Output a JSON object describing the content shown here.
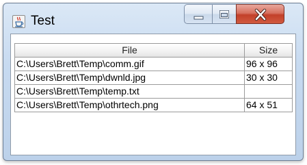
{
  "window": {
    "title": "Test"
  },
  "table": {
    "columns": [
      "File",
      "Size"
    ],
    "rows": [
      {
        "file": "C:\\Users\\Brett\\Temp\\comm.gif",
        "size": "96 x 96"
      },
      {
        "file": "C:\\Users\\Brett\\Temp\\dwnld.jpg",
        "size": "30 x 30"
      },
      {
        "file": "C:\\Users\\Brett\\Temp\\temp.txt",
        "size": ""
      },
      {
        "file": "C:\\Users\\Brett\\Temp\\othrtech.png",
        "size": "64 x 51"
      }
    ]
  },
  "icons": {
    "app": "java-coffee-cup-icon",
    "minimize": "minimize-icon",
    "maximize": "maximize-icon",
    "close": "close-icon"
  },
  "colors": {
    "close_button": "#c7452e",
    "titlebar": "#c9dbf0"
  }
}
